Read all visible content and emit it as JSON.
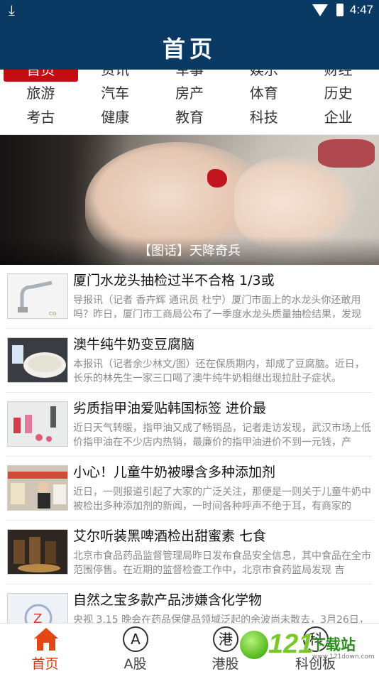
{
  "status_bar": {
    "time": "4:47"
  },
  "header": {
    "title": "首页"
  },
  "categories": {
    "row0": [
      "首页",
      "资讯",
      "军事",
      "娱乐",
      "财经"
    ],
    "row1": [
      "旅游",
      "汽车",
      "房产",
      "体育",
      "历史"
    ],
    "row2": [
      "考古",
      "健康",
      "教育",
      "科技",
      "企业"
    ]
  },
  "banner": {
    "caption": "【图话】天降奇兵"
  },
  "articles": [
    {
      "title": "厦门水龙头抽检过半不合格 1/3或",
      "desc": "导报讯（记者 香卉辉 通讯员 杜宁）厦门市面上的水龙头你还敢用吗？昨日，厦门市工商局公布了一季度水龙头质量抽检结果，发现"
    },
    {
      "title": "澳牛纯牛奶变豆腐脑",
      "desc": "本报讯（记者余少林文/图）还在保质期内，却成了豆腐脑。近日，长乐的林先生一家三口喝了澳牛纯牛奶相继出现拉肚子症状。"
    },
    {
      "title": "劣质指甲油爱贴韩国标签 进价最",
      "desc": "近日天气转暖，指甲油又成了畅销品，记者走访发现，武汉市场上低价指甲油在不少店内热销，最廉价的指甲油进价不到一元钱，产"
    },
    {
      "title": "小心！儿童牛奶被曝含多种添加剂",
      "desc": "近日，一则报道引起了大家的广泛关注，那便是一则关于儿童牛奶中被检出多种添加剂的新闻，一时间各种呼声不绝于耳，有商家的"
    },
    {
      "title": "艾尔听装黑啤酒检出甜蜜素 七食",
      "desc": "北京市食品药品监督管理局昨日发布食品安全信息，其中食品在全市范围停售。在近期的监督检查工作中，北京市食药监局发现 吉"
    },
    {
      "title": "自然之宝多款产品涉嫌含化学物",
      "desc": "央视 3.15 晚会在药品保健品领域泛起的余波尚未散去，3月26日，"
    }
  ],
  "tabbar": {
    "tabs": [
      {
        "label": "首页",
        "icon_char": ""
      },
      {
        "label": "A股",
        "icon_char": "A"
      },
      {
        "label": "港股",
        "icon_char": "港"
      },
      {
        "label": "科创板",
        "icon_char": "科"
      }
    ]
  },
  "watermark": {
    "number": "121",
    "text": "下载站",
    "url": "www.121down.com"
  },
  "colors": {
    "header": "#0a3a63",
    "active_category": "#c40c12",
    "active_tab": "#d23a14"
  }
}
